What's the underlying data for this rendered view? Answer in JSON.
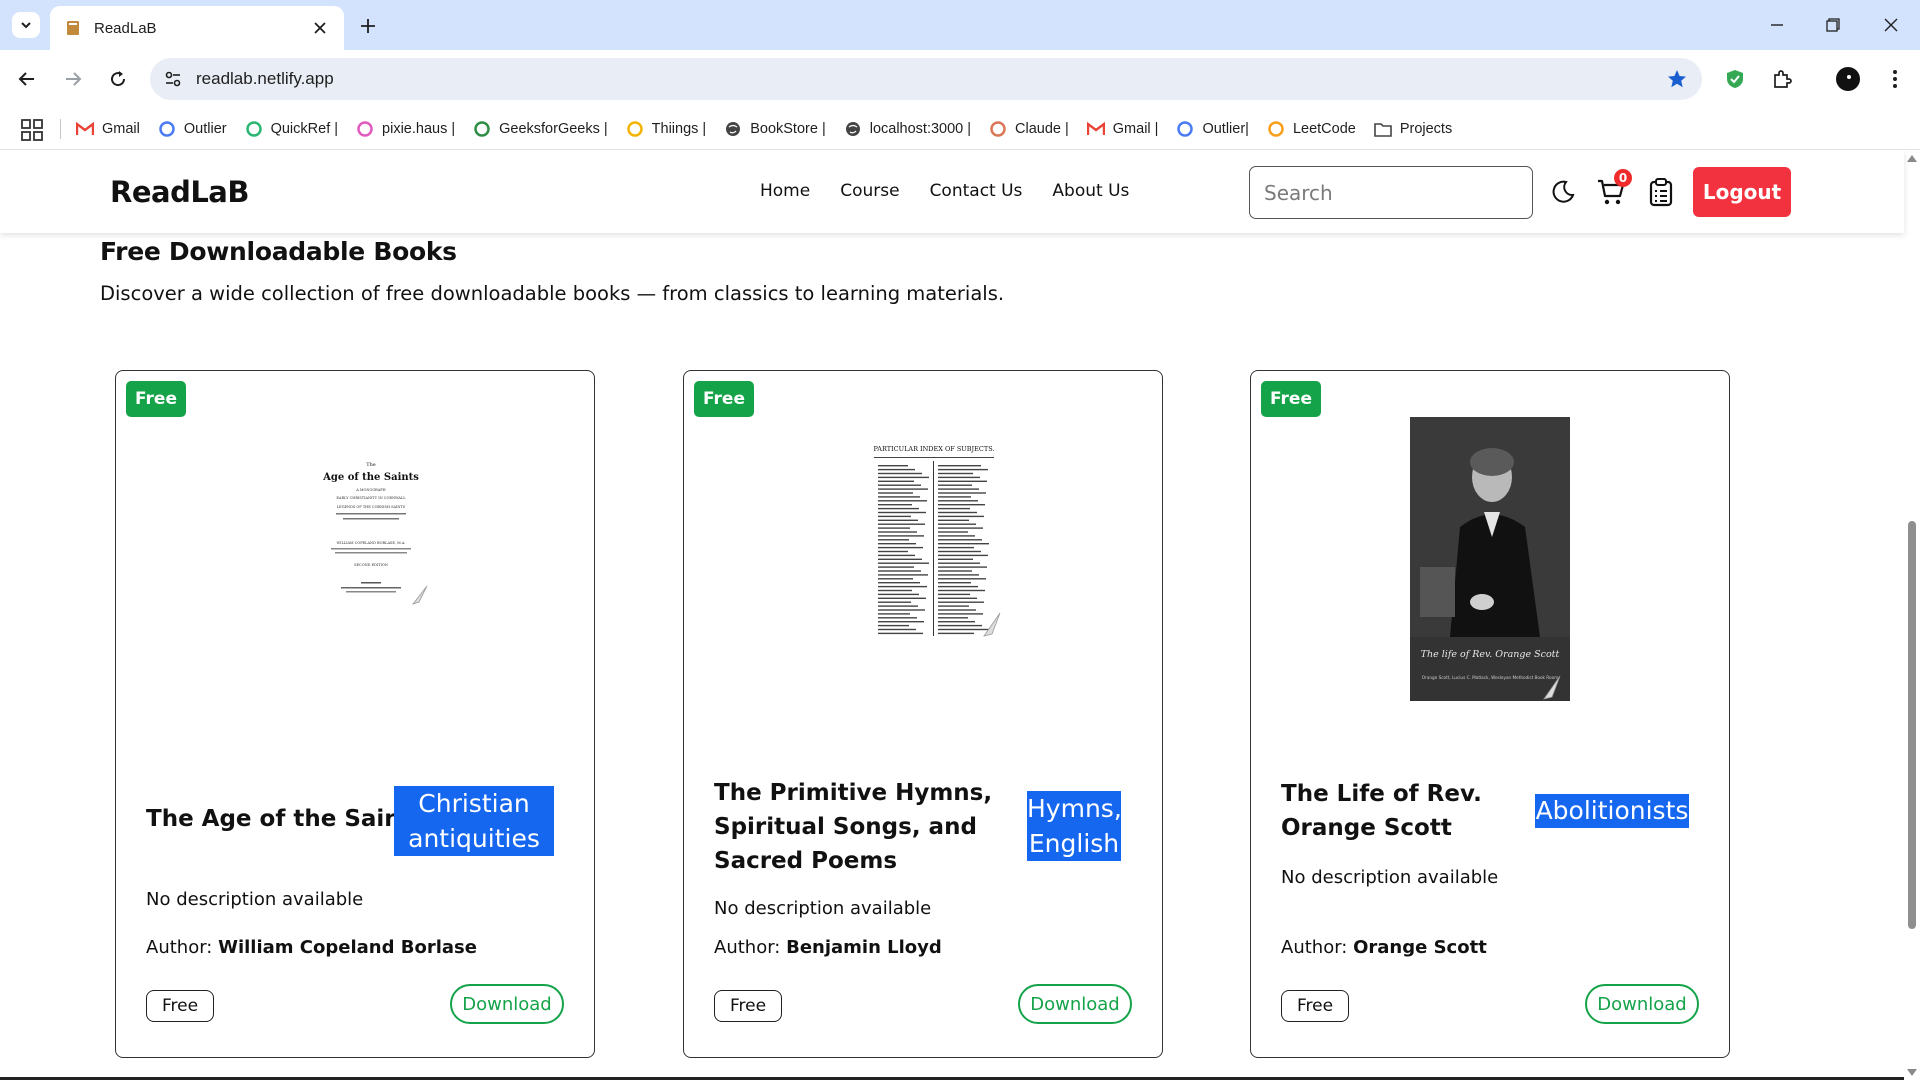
{
  "browser": {
    "tab_title": "ReadLaB",
    "url": "readlab.netlify.app",
    "bookmarks": [
      {
        "label": "Gmail",
        "icon": "gmail-icon",
        "color": "#ea4335"
      },
      {
        "label": "Outlier",
        "icon": "outlier-icon",
        "color": "#4a7cf6"
      },
      {
        "label": "QuickRef |",
        "icon": "quickref-icon",
        "color": "#2bb673"
      },
      {
        "label": "pixie.haus |",
        "icon": "pixie-icon",
        "color": "#e05bbd"
      },
      {
        "label": "GeeksforGeeks |",
        "icon": "gfg-icon",
        "color": "#2f8d46"
      },
      {
        "label": "Thiings |",
        "icon": "thiings-icon",
        "color": "#f5b400"
      },
      {
        "label": "BookStore |",
        "icon": "globe-icon",
        "color": "#444444"
      },
      {
        "label": "localhost:3000 |",
        "icon": "globe-icon",
        "color": "#444444"
      },
      {
        "label": "Claude |",
        "icon": "claude-icon",
        "color": "#d97757"
      },
      {
        "label": "Gmail |",
        "icon": "gmail-icon",
        "color": "#ea4335"
      },
      {
        "label": "Outlier|",
        "icon": "outlier-icon",
        "color": "#4a7cf6"
      },
      {
        "label": "LeetCode",
        "icon": "leetcode-icon",
        "color": "#f89f1b"
      },
      {
        "label": "Projects",
        "icon": "folder-icon",
        "color": "#444444"
      }
    ]
  },
  "site": {
    "brand": "ReadLaB",
    "menu": [
      "Home",
      "Course",
      "Contact Us",
      "About Us"
    ],
    "search_placeholder": "Search",
    "cart_count": "0",
    "logout_label": "Logout",
    "colors": {
      "accent_red": "#f3323f",
      "green": "#15a34a",
      "subject_blue": "#1567f0"
    }
  },
  "section": {
    "title": "Free Downloadable Books",
    "description": "Discover a wide collection of free downloadable books — from classics to learning materials."
  },
  "books": [
    {
      "badge": "Free",
      "cover_text": [
        "The",
        "Age of the Saints",
        "A MONOGRAPH",
        "EARLY CHRISTIANITY IN CORNWALL",
        "LEGENDS OF THE CORNISH SAINTS",
        "WILLIAM COPELAND BORLASE, M.A.",
        "SECOND EDITION"
      ],
      "title_lines": [
        "The Age of the Saints"
      ],
      "subject_lines": [
        "Christian",
        "antiquities"
      ],
      "description": "No description available",
      "author_label": "Author:",
      "author": "William Copeland Borlase",
      "price": "Free",
      "download_label": "Download"
    },
    {
      "badge": "Free",
      "cover_text": [
        "PARTICULAR INDEX OF SUBJECTS."
      ],
      "title_lines": [
        "The Primitive Hymns,",
        "Spiritual Songs, and",
        "Sacred Poems"
      ],
      "subject_lines": [
        "Hymns,",
        "English"
      ],
      "description": "No description available",
      "author_label": "Author:",
      "author": "Benjamin Lloyd",
      "price": "Free",
      "download_label": "Download"
    },
    {
      "badge": "Free",
      "cover_text": [
        "The life of Rev. Orange Scott",
        "Orange Scott, Lucius C. Matlack, Wesleyan Methodist Book Room"
      ],
      "title_lines": [
        "The Life of Rev.",
        "Orange Scott"
      ],
      "subject_lines": [
        "Abolitionists"
      ],
      "description": "No description available",
      "author_label": "Author:",
      "author": "Orange Scott",
      "price": "Free",
      "download_label": "Download"
    }
  ]
}
